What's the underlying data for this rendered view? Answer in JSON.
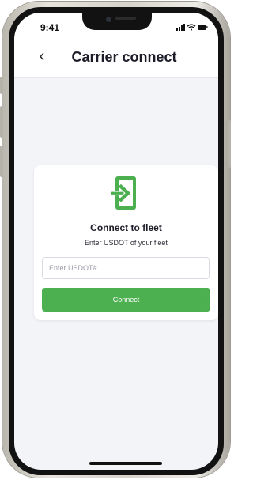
{
  "status_bar": {
    "time": "9:41",
    "icons": [
      "signal-icon",
      "wifi-icon",
      "battery-icon"
    ]
  },
  "header": {
    "back_icon": "chevron-left-icon",
    "back_glyph": "‹",
    "title": "Carrier connect"
  },
  "card": {
    "icon": "sign-in-icon",
    "title": "Connect to fleet",
    "subtitle": "Enter USDOT of your fleet",
    "input": {
      "value": "",
      "placeholder": "Enter USDOT#"
    },
    "button_label": "Connect"
  },
  "colors": {
    "accent": "#4caf50",
    "background": "#f3f4f8",
    "card": "#ffffff",
    "text": "#1c1c28"
  }
}
